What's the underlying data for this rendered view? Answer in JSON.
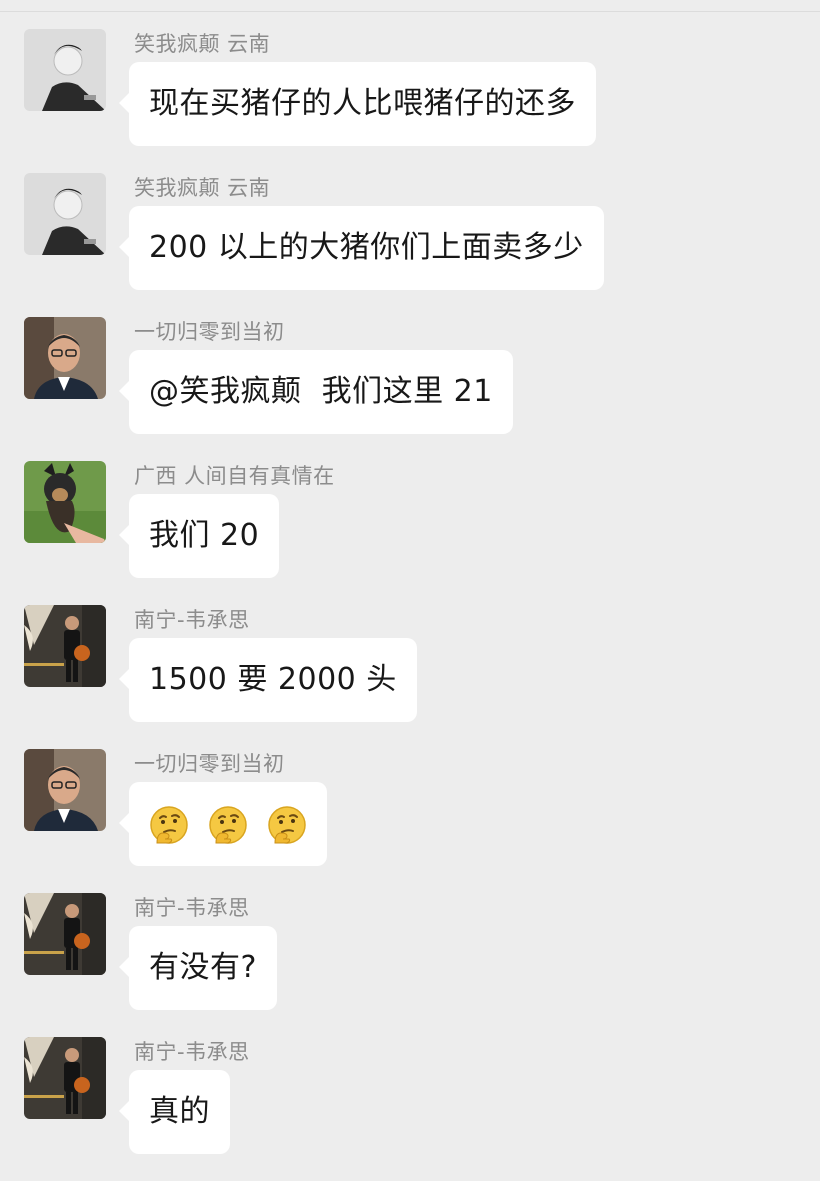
{
  "chat": {
    "messages": [
      {
        "sender": "笑我疯颠 云南",
        "text": "现在买猪仔的人比喂猪仔的还多",
        "avatar": "avatar-young-man-bw"
      },
      {
        "sender": "笑我疯颠 云南",
        "text": "200 以上的大猪你们上面卖多少",
        "avatar": "avatar-young-man-bw"
      },
      {
        "sender": "一切归零到当初",
        "text": "@笑我疯颠  我们这里 21",
        "avatar": "avatar-man-glasses"
      },
      {
        "sender": "广西 人间自有真情在",
        "text": "我们 20",
        "avatar": "avatar-dog"
      },
      {
        "sender": "南宁-韦承思",
        "text": "1500 要 2000 头",
        "avatar": "avatar-man-basketball"
      },
      {
        "sender": "一切归零到当初",
        "emojis": [
          "thinking-face-icon",
          "thinking-face-icon",
          "thinking-face-icon"
        ],
        "avatar": "avatar-man-glasses"
      },
      {
        "sender": "南宁-韦承思",
        "text": "有没有?",
        "avatar": "avatar-man-basketball"
      },
      {
        "sender": "南宁-韦承思",
        "text": "真的",
        "avatar": "avatar-man-basketball"
      }
    ]
  },
  "colors": {
    "background": "#ededed",
    "bubble": "#ffffff",
    "sender_text": "#8c8c8c",
    "message_text": "#181818",
    "emoji_face": "#f5c842"
  }
}
